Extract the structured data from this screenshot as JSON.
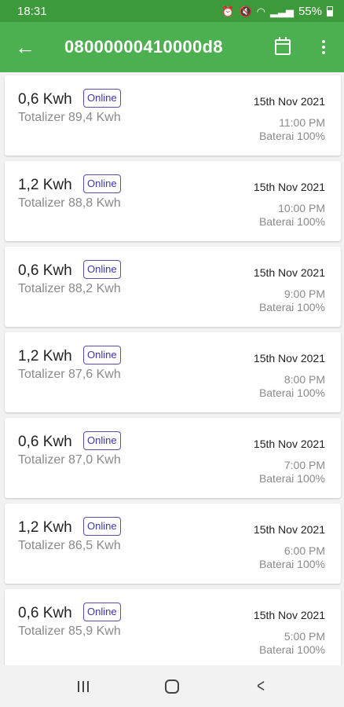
{
  "status_bar": {
    "time": "18:31",
    "battery_percent": "55%",
    "icons": [
      "alarm-icon",
      "mute-icon",
      "wifi-icon",
      "signal-icon",
      "battery-icon"
    ]
  },
  "app_bar": {
    "title": "08000000410000d8",
    "back_icon": "arrow-left-icon",
    "actions": [
      "calendar-icon",
      "more-vert-icon"
    ]
  },
  "colors": {
    "status_bar": "#3d9a3a",
    "app_bar": "#4caf50",
    "badge_border": "#5c4db1"
  },
  "readings": [
    {
      "kwh": "0,6 Kwh",
      "status": "Online",
      "totalizer": "Totalizer 89,4  Kwh",
      "date": "15th Nov 2021",
      "time": "11:00 PM",
      "battery": "Baterai 100%"
    },
    {
      "kwh": "1,2 Kwh",
      "status": "Online",
      "totalizer": "Totalizer 88,8  Kwh",
      "date": "15th Nov 2021",
      "time": "10:00 PM",
      "battery": "Baterai 100%"
    },
    {
      "kwh": "0,6 Kwh",
      "status": "Online",
      "totalizer": "Totalizer 88,2  Kwh",
      "date": "15th Nov 2021",
      "time": "9:00 PM",
      "battery": "Baterai 100%"
    },
    {
      "kwh": "1,2 Kwh",
      "status": "Online",
      "totalizer": "Totalizer 87,6  Kwh",
      "date": "15th Nov 2021",
      "time": "8:00 PM",
      "battery": "Baterai 100%"
    },
    {
      "kwh": "0,6 Kwh",
      "status": "Online",
      "totalizer": "Totalizer 87,0  Kwh",
      "date": "15th Nov 2021",
      "time": "7:00 PM",
      "battery": "Baterai 100%"
    },
    {
      "kwh": "1,2 Kwh",
      "status": "Online",
      "totalizer": "Totalizer 86,5  Kwh",
      "date": "15th Nov 2021",
      "time": "6:00 PM",
      "battery": "Baterai 100%"
    },
    {
      "kwh": "0,6 Kwh",
      "status": "Online",
      "totalizer": "Totalizer 85,9  Kwh",
      "date": "15th Nov 2021",
      "time": "5:00 PM",
      "battery": "Baterai 100%"
    }
  ],
  "nav_bar": {
    "buttons": [
      "recents-icon",
      "home-icon",
      "back-icon"
    ]
  }
}
